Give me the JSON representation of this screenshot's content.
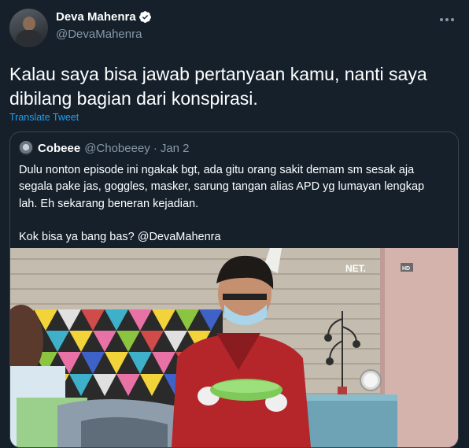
{
  "tweet": {
    "display_name": "Deva Mahenra",
    "handle": "@DevaMahenra",
    "text": "Kalau saya bisa jawab pertanyaan kamu, nanti saya dibilang bagian dari konspirasi.",
    "translate_label": "Translate Tweet",
    "verified_color": "#1da1f2"
  },
  "quoted": {
    "display_name": "Cobeee",
    "handle": "@Chobeeey",
    "separator": "·",
    "date": "Jan 2",
    "lines": [
      "Dulu nonton episode ini ngakak bgt, ada gitu orang sakit demam sm sesak aja",
      "segala pake jas, goggles, masker, sarung tangan alias APD yg lumayan lengkap",
      "lah. Eh sekarang beneran kejadian."
    ],
    "line2": "Kok bisa ya bang bas? @DevaMahenra",
    "media": {
      "watermark": "NET.",
      "badge": "HD"
    }
  },
  "colors": {
    "background": "#15202b",
    "secondary_text": "#8899a6",
    "link": "#1da1f2",
    "border": "#38444d"
  },
  "icons": [
    "verified-badge-icon",
    "more-options-icon"
  ]
}
